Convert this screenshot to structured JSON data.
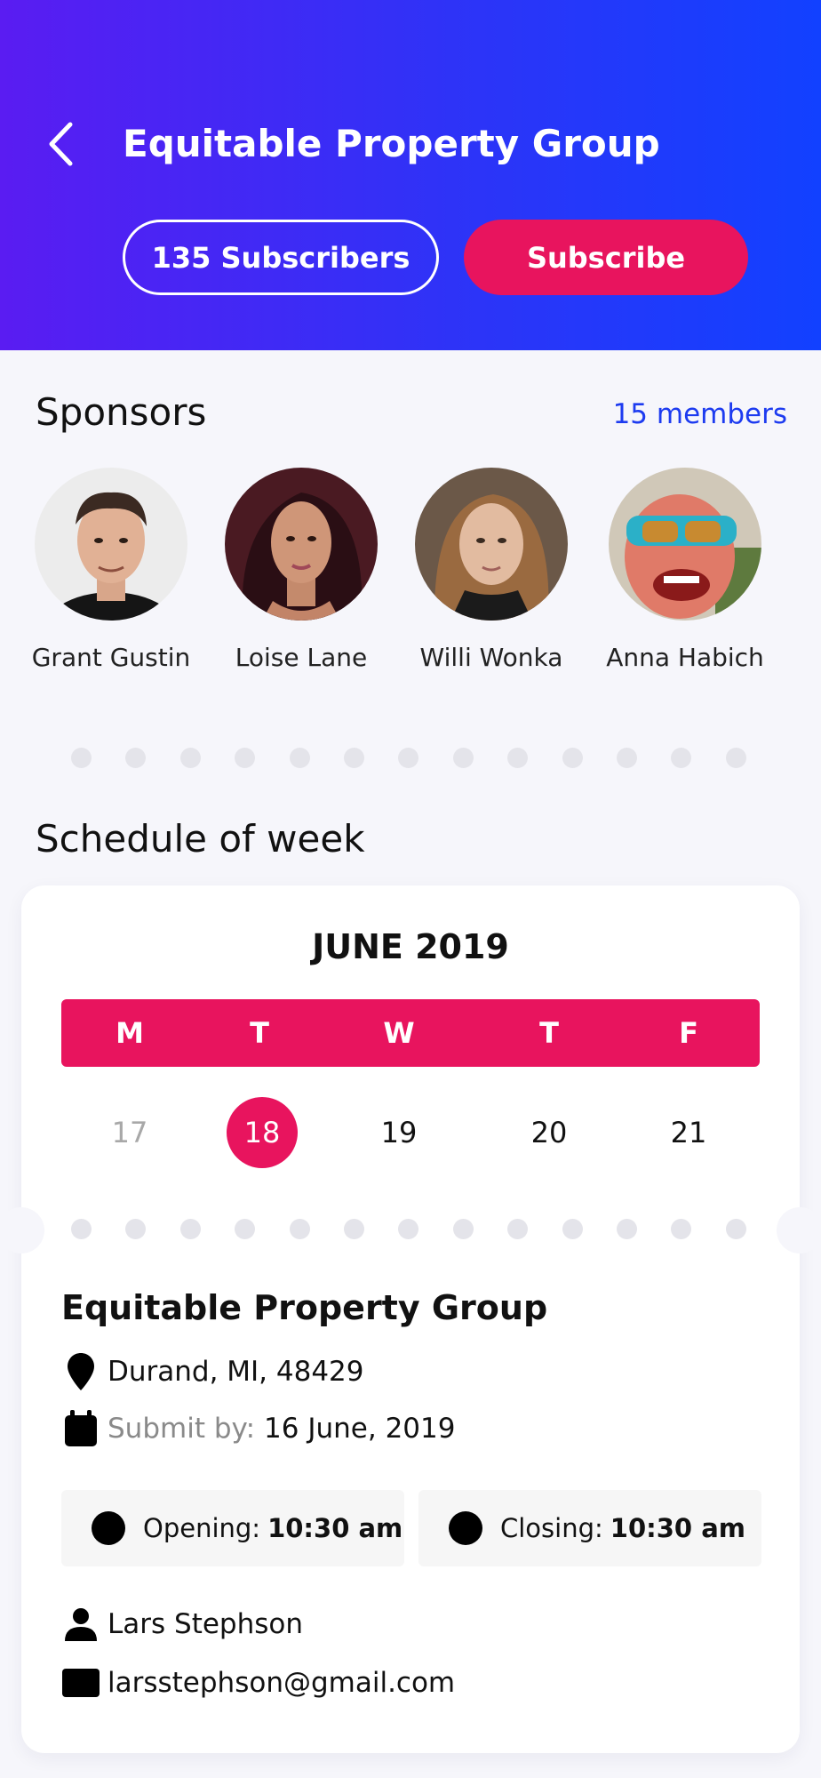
{
  "header": {
    "title": "Equitable Property Group",
    "subscribers_label": "135 Subscribers",
    "subscribe_label": "Subscribe",
    "back_icon": "chevron-left-icon"
  },
  "sponsors": {
    "title": "Sponsors",
    "members_link": "15 members",
    "items": [
      {
        "name": "Grant Gustin"
      },
      {
        "name": "Loise Lane"
      },
      {
        "name": "Willi Wonka"
      },
      {
        "name": "Anna Habich"
      }
    ]
  },
  "schedule": {
    "title": "Schedule of week",
    "month": "JUNE 2019",
    "weekdays": [
      "M",
      "T",
      "W",
      "T",
      "F"
    ],
    "days": [
      "17",
      "18",
      "19",
      "20",
      "21"
    ],
    "selected_day": "18"
  },
  "event": {
    "title": "Equitable Property Group",
    "location": "Durand, MI, 48429",
    "submit_label": "Submit by:",
    "submit_date": "16 June, 2019",
    "opening_label": "Opening:",
    "opening_time": "10:30 am",
    "closing_label": "Closing:",
    "closing_time": "10:30 am",
    "contact_name": "Lars Stephson",
    "contact_email": "larsstephson@gmail.com"
  },
  "colors": {
    "accent": "#e8145e",
    "header_gradient_start": "#5a1cf2",
    "header_gradient_end": "#1241ff",
    "link": "#1d3bf0"
  }
}
